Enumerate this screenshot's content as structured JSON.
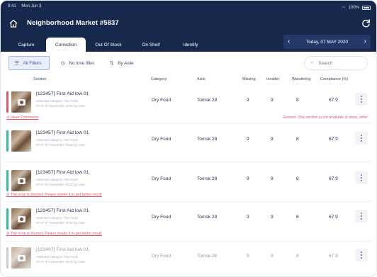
{
  "status_bar": {
    "time": "9:41",
    "date": "Mon Jun 3",
    "battery": "100%"
  },
  "header": {
    "title": "Neighborhood Market #5837"
  },
  "tabs": [
    "Capture",
    "Correction",
    "Out Of Stock",
    "On Shelf",
    "Identify"
  ],
  "active_tab": "Correction",
  "date_nav": {
    "date": "Today, 07 MAY 2020"
  },
  "filters": {
    "all": "All Filters",
    "time": "No time filter",
    "aisle": "By Aisle",
    "search_placeholder": "Search"
  },
  "columns": [
    "Section",
    "Category",
    "Aisle",
    "Missing",
    "Invader",
    "Wandering",
    "Compliance (%)"
  ],
  "colors": {
    "header": "#17284d",
    "red": "#e3546a",
    "green": "#2fc186",
    "grey": "#c7cbd5",
    "accent": "#3e58a7"
  },
  "rows": [
    {
      "name": "[123457] First Aid low 01",
      "sub1": "Selected category: Fist Food",
      "sub2": "07:07 07 November 2019 by User",
      "category": "Dry Food",
      "aisle": "Tomsk 28",
      "missing": "9",
      "invader": "9",
      "wandering": "8",
      "compliance": "67.9",
      "status": "red",
      "flag": "Have Comments",
      "reason_label": "Reason:",
      "reason": "This section is not available in store, other"
    },
    {
      "name": "[123457] First Aid low 01",
      "sub1": "Selected category: Fist Food",
      "sub2": "07:07 07 November 2019 by User",
      "category": "Dry Food",
      "aisle": "Tomsk 28",
      "missing": "9",
      "invader": "9",
      "wandering": "8",
      "compliance": "67.9",
      "status": "green"
    },
    {
      "name": "[123457] First Aid low 01",
      "sub1": "Selected category: Fist Food",
      "sub2": "07:07 07 November 2019 by User",
      "category": "Dry Food",
      "aisle": "Tomsk 28",
      "missing": "9",
      "invader": "9",
      "wandering": "8",
      "compliance": "67.9",
      "status": "green",
      "flag": "The scan is blurred. Please retake it to get better result"
    },
    {
      "name": "[123457] First Aid low 01",
      "sub1": "Selected category: Fist Food",
      "sub2": "07:07 07 November 2019 by User",
      "category": "Dry Food",
      "aisle": "Tomsk 28",
      "missing": "9",
      "invader": "9",
      "wandering": "8",
      "compliance": "67.9",
      "status": "green",
      "flag": "The scan is blurred. Please retake it to get better result"
    },
    {
      "name": "[123457] First Aid low 01",
      "sub1": "Selected category: Fist Food",
      "sub2": "07:07 07 November 2019 by User",
      "category": "Dry Food",
      "aisle": "Tomsk 28",
      "missing": "9",
      "invader": "9",
      "wandering": "8",
      "compliance": "67.9",
      "status": "grey"
    }
  ]
}
